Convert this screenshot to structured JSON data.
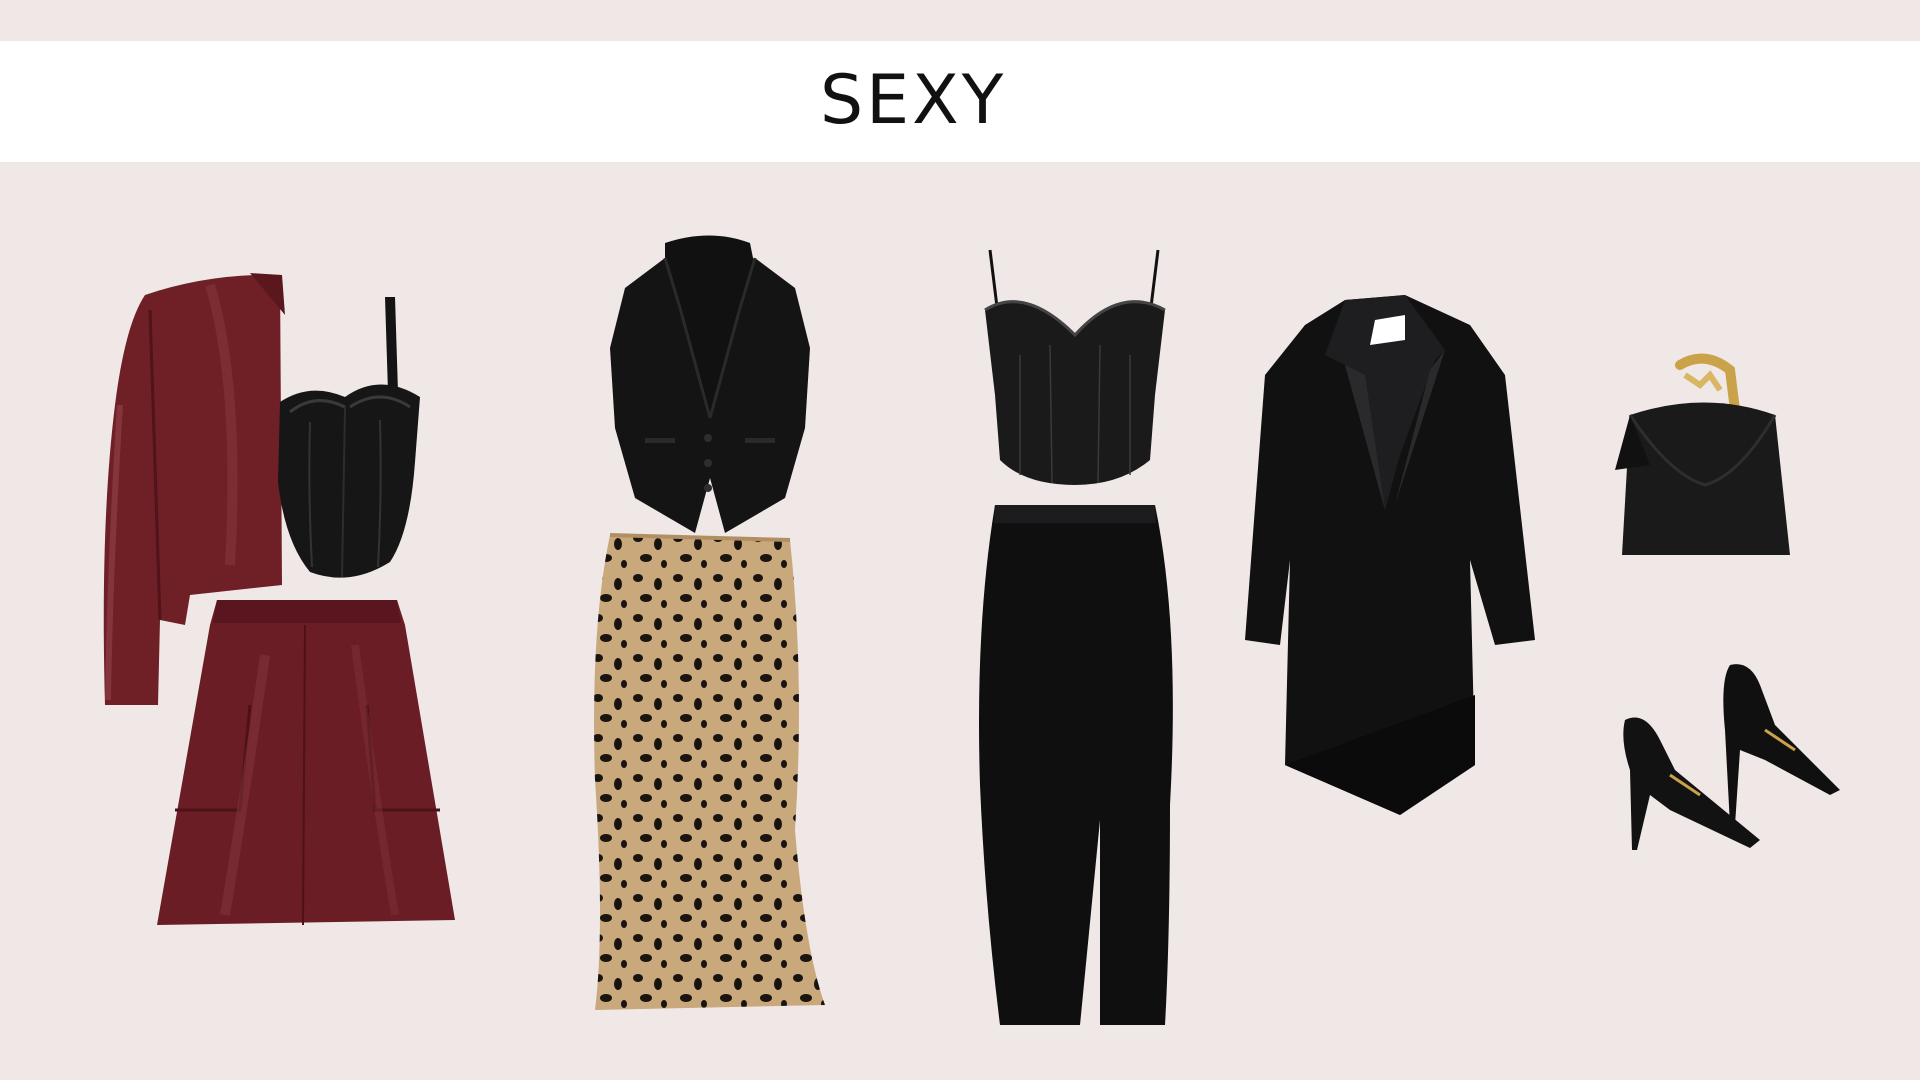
{
  "page": {
    "title": "SEXY",
    "background_color": "#efe8e7",
    "header_color": "#ffffff"
  },
  "palette": {
    "burgundy": "#6e1f27",
    "burgundy_light": "#8a3a40",
    "black": "#0f0f10",
    "black_soft": "#242426",
    "leopard_base": "#c7a77b",
    "gold": "#c9a24a"
  },
  "outfits": [
    {
      "name": "outfit-1",
      "items": [
        "burgundy-leather-jacket",
        "black-leather-bustier",
        "burgundy-leather-mini-skirt"
      ]
    },
    {
      "name": "outfit-2",
      "items": [
        "black-halter-vest",
        "leopard-satin-midi-skirt"
      ]
    },
    {
      "name": "outfit-3",
      "items": [
        "black-lace-corset-top",
        "black-knit-midi-skirt-with-slit"
      ]
    },
    {
      "name": "outfit-4",
      "items": [
        "black-tuxedo-blazer-dress"
      ]
    },
    {
      "name": "accessories",
      "items": [
        "black-chain-handbag",
        "black-patent-slingback-pumps"
      ]
    }
  ]
}
